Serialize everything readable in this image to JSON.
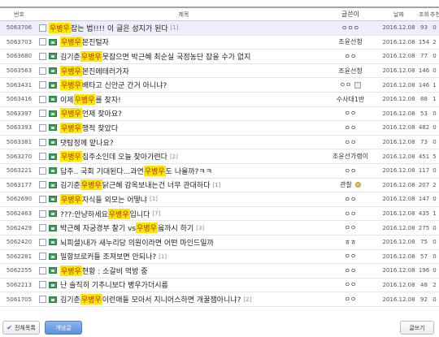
{
  "columns": {
    "num": "번호",
    "title": "제목",
    "writer": "글쓴이",
    "date": "날짜",
    "views": "조회",
    "rec": "추천"
  },
  "rows": [
    {
      "num": "5063706",
      "img": false,
      "pre": "",
      "hl": "우병우",
      "post": " 잡는 법!!!! 이 글은 성지가 된다",
      "cmt": "[1]",
      "writer": "ㅇㅇㅇ",
      "wicon": "",
      "date": "2016.12.08",
      "views": "93",
      "rec": "0",
      "highlight": true
    },
    {
      "num": "5063703",
      "img": true,
      "pre": "",
      "hl": "우병우",
      "post": " 본진털자",
      "cmt": "",
      "writer": "조윤선청",
      "wicon": "",
      "date": "2016.12.08",
      "views": "154",
      "rec": "2"
    },
    {
      "num": "5063680",
      "img": true,
      "pre": "김기춘 ",
      "hl": "우병우",
      "post": " 못잡으면 박근혜 최순실 국정농단 잡을 수가 없지",
      "cmt": "",
      "writer": "ㅇㅇ",
      "wicon": "",
      "date": "2016.12.08",
      "views": "77",
      "rec": "0"
    },
    {
      "num": "5063563",
      "img": true,
      "pre": "",
      "hl": "우병우",
      "post": " 본진에테러가자",
      "cmt": "",
      "writer": "조윤선청",
      "wicon": "",
      "date": "2016.12.08",
      "views": "146",
      "rec": "0"
    },
    {
      "num": "5063431",
      "img": true,
      "pre": "",
      "hl": "우병우",
      "post": " 배타고 신안군 간거 아니냐?",
      "cmt": "",
      "writer": "ㅇㅇ",
      "wicon": "grey",
      "date": "2016.12.08",
      "views": "146",
      "rec": "1"
    },
    {
      "num": "5063416",
      "img": true,
      "pre": "이제 ",
      "hl": "우병우",
      "post": "를 찾자!",
      "cmt": "",
      "writer": "수사대1반",
      "wicon": "",
      "date": "2016.12.08",
      "views": "88",
      "rec": "1"
    },
    {
      "num": "5063397",
      "img": true,
      "pre": "",
      "hl": "우병우",
      "post": " 언제 찾아요?",
      "cmt": "",
      "writer": "ㅇㅇ",
      "wicon": "",
      "date": "2016.12.08",
      "views": "53",
      "rec": "0"
    },
    {
      "num": "5063393",
      "img": true,
      "pre": "",
      "hl": "우병우",
      "post": " 행적 찾았다",
      "cmt": "",
      "writer": "ㅇㅇ",
      "wicon": "",
      "date": "2016.12.08",
      "views": "482",
      "rec": "0"
    },
    {
      "num": "5063381",
      "img": true,
      "pre": "댓탐정께 맡나요?",
      "hl": "",
      "post": "",
      "cmt": "",
      "writer": "ㅇㅇ",
      "wicon": "",
      "date": "2016.12.08",
      "views": "73",
      "rec": "0"
    },
    {
      "num": "5063270",
      "img": true,
      "pre": "",
      "hl": "우병우",
      "post": " 집주소인데 오늘 찾아가련다",
      "cmt": "[2]",
      "writer": "조윤선가랭이",
      "wicon": "",
      "date": "2016.12.08",
      "views": "451",
      "rec": "5"
    },
    {
      "num": "5063221",
      "img": true,
      "pre": "답주.. 국회 기대된다...과연 ",
      "hl": "우병우",
      "post": "도 나올까?ㅋㅋ",
      "cmt": "",
      "writer": "ㅇㅇ",
      "wicon": "",
      "date": "2016.12.08",
      "views": "117",
      "rec": "0"
    },
    {
      "num": "5063177",
      "img": true,
      "pre": "김기춘 ",
      "hl": "우병우",
      "post": " 닭근혜 감옥보내는건 너무 관대하다",
      "cmt": "[1]",
      "writer": "관찰",
      "wicon": "gold",
      "date": "2016.12.08",
      "views": "207",
      "rec": "2"
    },
    {
      "num": "5062690",
      "img": true,
      "pre": "",
      "hl": "우병우",
      "post": " 자식들 외모는 어떻냐",
      "cmt": "[1]",
      "writer": "ㅇㅇ",
      "wicon": "",
      "date": "2016.12.08",
      "views": "147",
      "rec": "0"
    },
    {
      "num": "5062463",
      "img": true,
      "pre": "???:안냥하세요 ",
      "hl": "우병우",
      "post": "입니다",
      "cmt": "[7]",
      "writer": "ㅇㅇ",
      "wicon": "",
      "date": "2016.12.08",
      "views": "435",
      "rec": "1"
    },
    {
      "num": "5062429",
      "img": true,
      "pre": "박근혜 자궁경부 찰기 vs ",
      "hl": "우병우",
      "post": " 옳까시 하기",
      "cmt": "[3]",
      "writer": "ㅇㅇ",
      "wicon": "",
      "date": "2016.12.08",
      "views": "275",
      "rec": "0"
    },
    {
      "num": "5062420",
      "img": true,
      "pre": "뇌피셜)내가 새누리당 의원이라면 어떤 마인드일까",
      "hl": "",
      "post": "",
      "cmt": "",
      "writer": "ㅎㅎ",
      "wicon": "",
      "date": "2016.12.08",
      "views": "75",
      "rec": "0"
    },
    {
      "num": "5062281",
      "img": true,
      "pre": "밀항브로커들 조져보면 안되나?",
      "hl": "",
      "post": "",
      "cmt": "[1]",
      "writer": "ㅇㅇ",
      "wicon": "",
      "date": "2016.12.08",
      "views": "57",
      "rec": "0"
    },
    {
      "num": "5062255",
      "img": true,
      "pre": "",
      "hl": "우병우",
      "post": " 현황 : 소갈비 먹방 중",
      "cmt": "",
      "writer": "ㅇㅇ",
      "wicon": "",
      "date": "2016.12.08",
      "views": "196",
      "rec": "0"
    },
    {
      "num": "5062213",
      "img": true,
      "pre": "난 솔직히 기추니보다 병우가더시름",
      "hl": "",
      "post": "",
      "cmt": "",
      "writer": "ㅇㅇ",
      "wicon": "",
      "date": "2016.12.08",
      "views": "48",
      "rec": "2"
    },
    {
      "num": "5061705",
      "img": true,
      "pre": "김기춘 ",
      "hl": "우병우",
      "post": " 이런애들 모아서 지니어스하면 개꿀잼아니냐?",
      "cmt": "[2]",
      "writer": "ㅇㅇ",
      "wicon": "",
      "date": "2016.12.08",
      "views": "92",
      "rec": "0"
    }
  ],
  "footer": {
    "all_label": "전체목록",
    "concept_label": "개념글",
    "write_label": "글쓰기"
  }
}
